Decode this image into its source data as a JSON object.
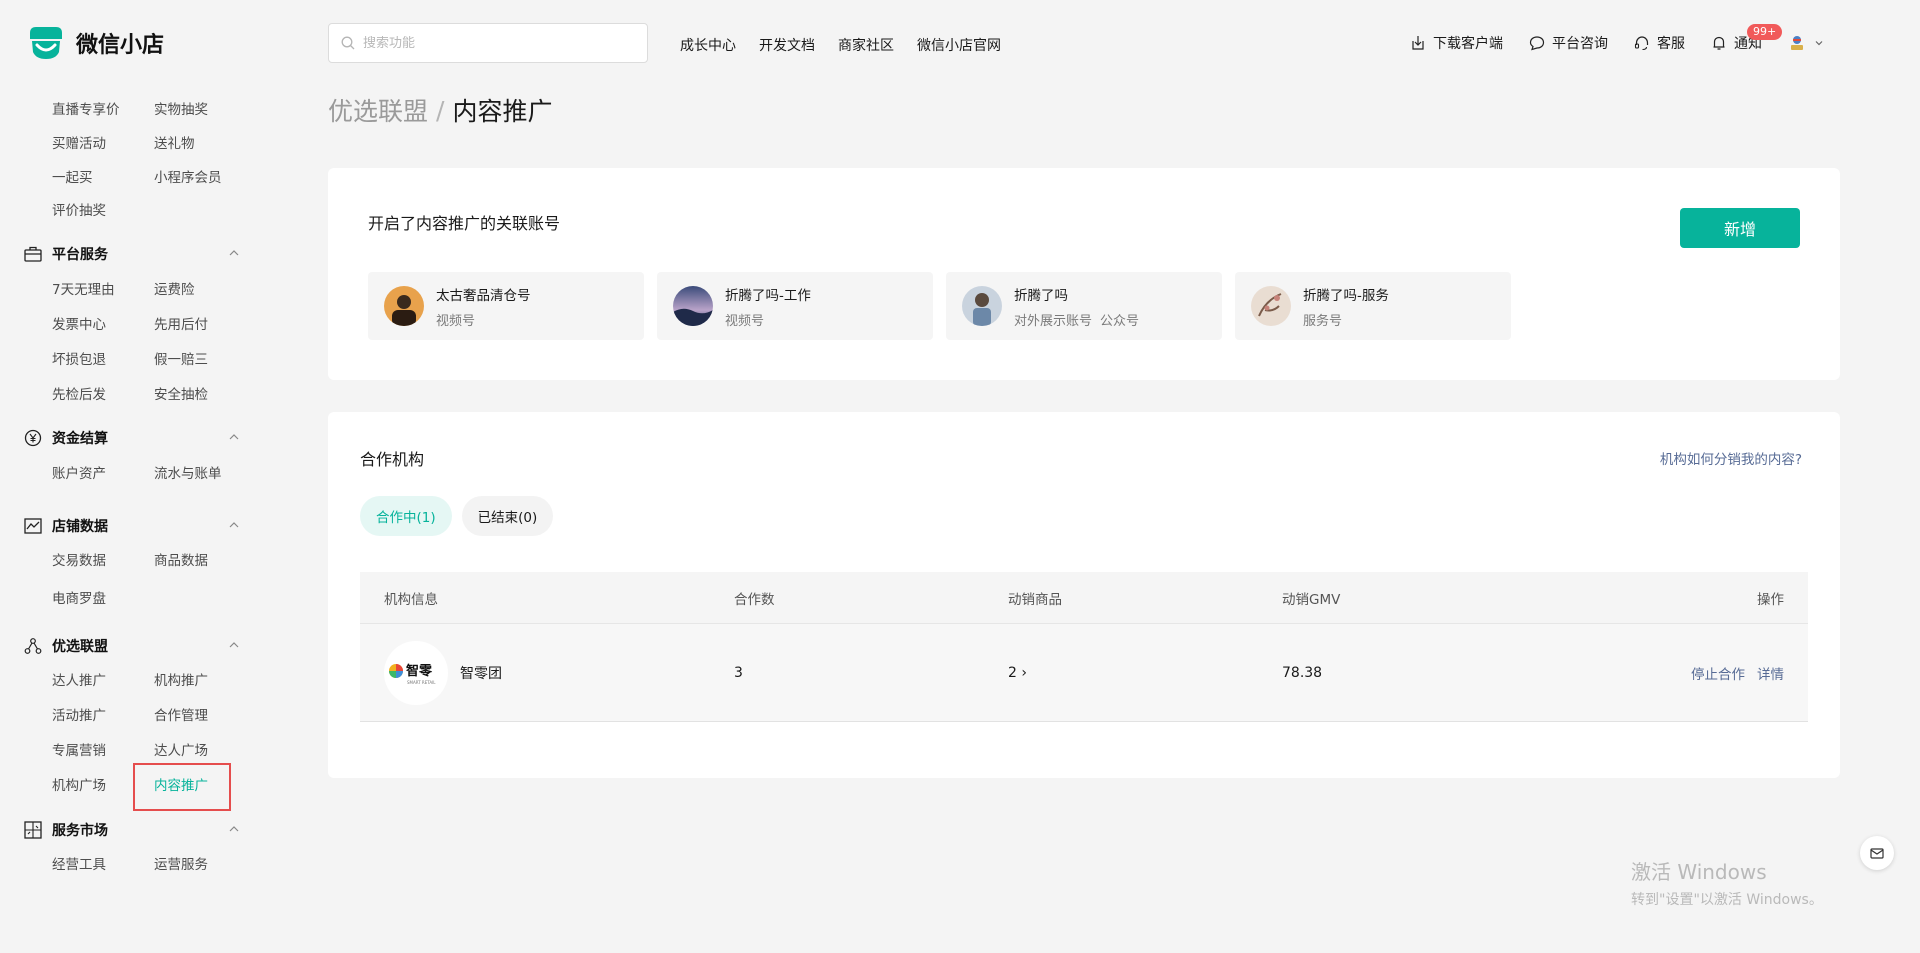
{
  "header": {
    "logo_text": "微信小店",
    "search_placeholder": "搜索功能",
    "nav": [
      "成长中心",
      "开发文档",
      "商家社区",
      "微信小店官网"
    ],
    "download": "下载客户端",
    "consult": "平台咨询",
    "service": "客服",
    "notify": "通知",
    "notify_badge": "99+"
  },
  "sidebar": {
    "top_items": [
      [
        "直播专享价",
        "实物抽奖"
      ],
      [
        "买赠活动",
        "送礼物"
      ],
      [
        "一起买",
        "小程序会员"
      ],
      [
        "评价抽奖"
      ]
    ],
    "groups": [
      {
        "title": "平台服务",
        "icon": "briefcase-icon",
        "items": [
          [
            "7天无理由",
            "运费险"
          ],
          [
            "发票中心",
            "先用后付"
          ],
          [
            "坏损包退",
            "假一赔三"
          ],
          [
            "先检后发",
            "安全抽检"
          ]
        ]
      },
      {
        "title": "资金结算",
        "icon": "yen-icon",
        "items": [
          [
            "账户资产",
            "流水与账单"
          ]
        ]
      },
      {
        "title": "店铺数据",
        "icon": "chart-icon",
        "items": [
          [
            "交易数据",
            "商品数据"
          ],
          [
            "电商罗盘"
          ]
        ]
      },
      {
        "title": "优选联盟",
        "icon": "network-icon",
        "items": [
          [
            "达人推广",
            "机构推广"
          ],
          [
            "活动推广",
            "合作管理"
          ],
          [
            "专属营销",
            "达人广场"
          ],
          [
            "机构广场",
            "内容推广"
          ]
        ]
      },
      {
        "title": "服务市场",
        "icon": "market-icon",
        "items": [
          [
            "经营工具",
            "运营服务"
          ]
        ]
      }
    ]
  },
  "breadcrumb": {
    "parent": "优选联盟",
    "sep": "/",
    "current": "内容推广"
  },
  "accounts_card": {
    "title": "开启了内容推广的关联账号",
    "add_button": "新增",
    "accounts": [
      {
        "name": "太古奢品清仓号",
        "types": [
          "视频号"
        ],
        "color": "#d98a3a"
      },
      {
        "name": "折腾了吗-工作",
        "types": [
          "视频号"
        ],
        "color": "#5b6a93"
      },
      {
        "name": "折腾了吗",
        "types": [
          "对外展示账号",
          "公众号"
        ],
        "color": "#7d8fa6"
      },
      {
        "name": "折腾了吗-服务",
        "types": [
          "服务号"
        ],
        "color": "#c9a58f"
      }
    ]
  },
  "org_card": {
    "title": "合作机构",
    "help_link": "机构如何分销我的内容?",
    "tabs": [
      "合作中(1)",
      "已结束(0)"
    ],
    "columns": [
      "机构信息",
      "合作数",
      "动销商品",
      "动销GMV",
      "操作"
    ],
    "rows": [
      {
        "org_logo_text": "智零",
        "org_logo_sub": "SMART RETAIL",
        "org_name": "智零团",
        "coop_count": "3",
        "products": "2 ›",
        "gmv": "78.38",
        "actions": [
          "停止合作",
          "详情"
        ]
      }
    ]
  },
  "watermark": {
    "line1": "激活 Windows",
    "line2": "转到\"设置\"以激活 Windows。"
  },
  "colors": {
    "accent": "#07b39b",
    "link": "#576b95",
    "badge": "#f15a5a"
  }
}
